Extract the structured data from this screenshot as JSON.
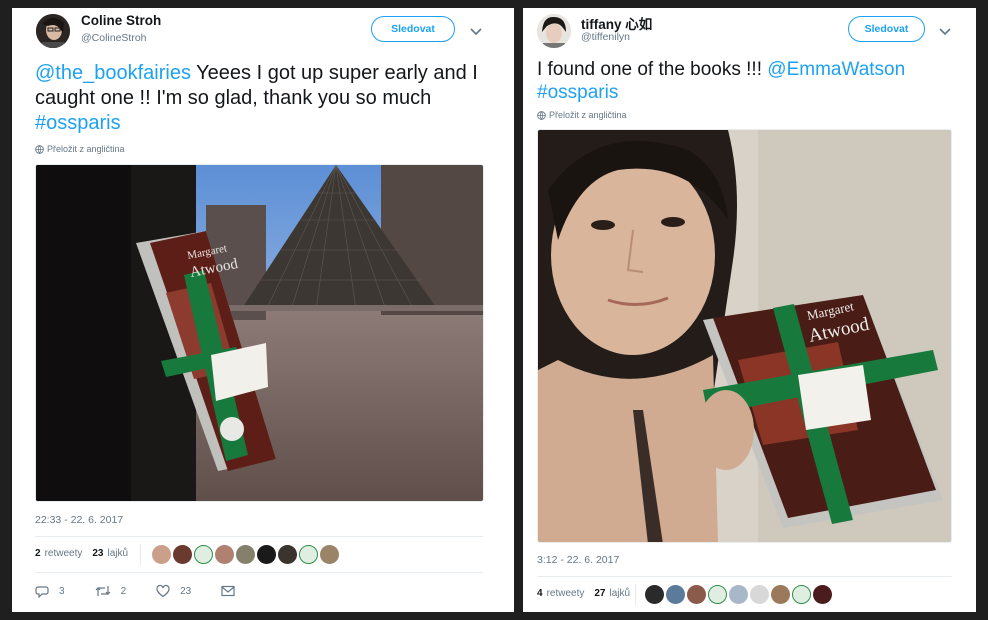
{
  "tweet1": {
    "name": "Coline Stroh",
    "handle": "@ColineStroh",
    "follow_label": "Sledovat",
    "text_mention": "@the_bookfairies",
    "text_body": " Yeees I got up super early and I caught one !! I'm so glad, thank you so much ",
    "text_hashtag": "#ossparis",
    "translate_label": "Přeložit z angličtina",
    "timestamp": "22:33 - 22. 6. 2017",
    "retweets_count": "2",
    "retweets_label": "retweety",
    "likes_count": "23",
    "likes_label": "lajků",
    "reply_count": "3",
    "retweet_count": "2",
    "like_count": "23"
  },
  "tweet2": {
    "name": "tiffany 心如",
    "handle": "@tiffenilyn",
    "follow_label": "Sledovat",
    "text_body": "I found one of the books !!! ",
    "text_mention": "@EmmaWatson",
    "text_hashtag": "#ossparis",
    "translate_label": "Přeložit z angličtina",
    "timestamp": "3:12 - 22. 6. 2017",
    "retweets_count": "4",
    "retweets_label": "retweety",
    "likes_count": "27",
    "likes_label": "lajků"
  },
  "colors": {
    "accent": "#1da1f2",
    "text": "#14171a",
    "muted": "#657786",
    "divider": "#e6ecf0"
  },
  "icons": [
    "globe-icon",
    "chevron-down-icon",
    "reply-icon",
    "retweet-icon",
    "heart-icon",
    "mail-icon"
  ]
}
